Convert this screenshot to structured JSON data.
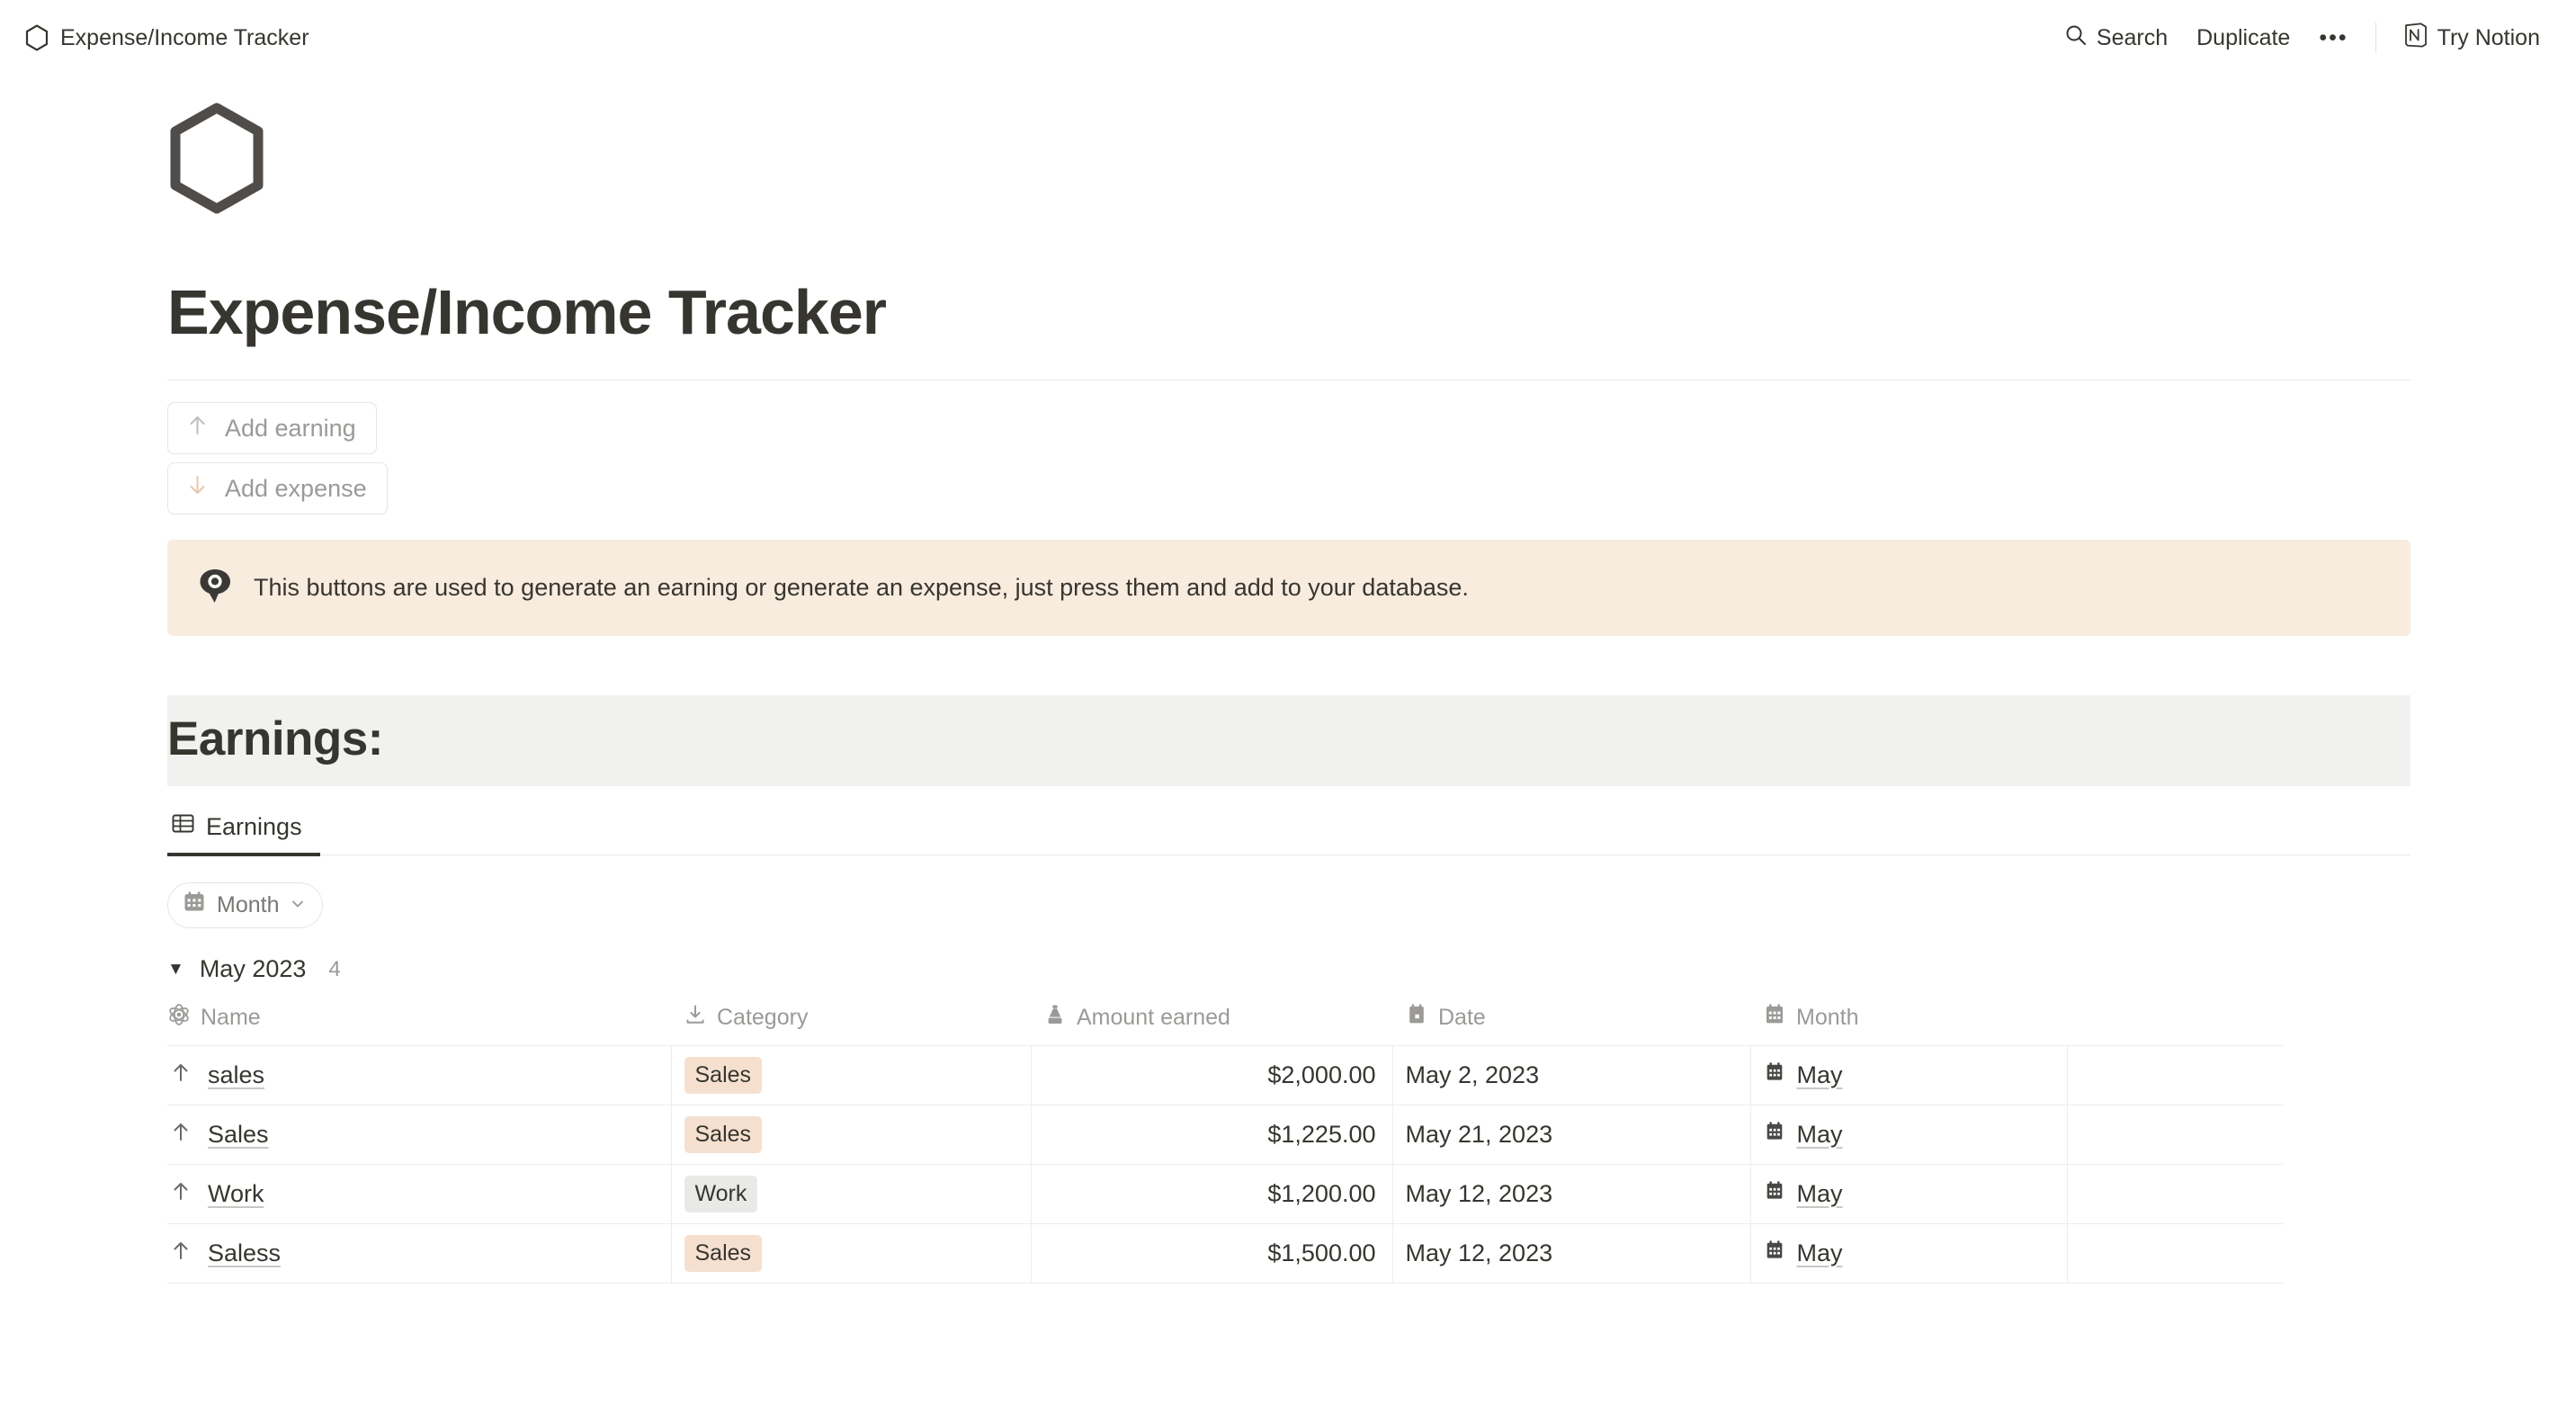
{
  "topbar": {
    "workspace_title": "Expense/Income Tracker",
    "search_label": "Search",
    "duplicate_label": "Duplicate",
    "more_label": "•••",
    "try_notion_label": "Try Notion"
  },
  "page": {
    "title": "Expense/Income Tracker"
  },
  "buttons": [
    {
      "label": "Add earning",
      "icon": "arrow-up-icon",
      "icon_color": "#bfbfbc"
    },
    {
      "label": "Add expense",
      "icon": "arrow-down-icon",
      "icon_color": "#e6c9ac"
    }
  ],
  "callout": {
    "icon": "eye-icon",
    "background": "#f8ecdf",
    "text": "This buttons are used to generate an earning or generate an expense, just press them and add to your database."
  },
  "section": {
    "heading": "Earnings:",
    "heading_background": "#f1f1ef"
  },
  "tabs": [
    {
      "label": "Earnings",
      "icon": "table-icon",
      "active": true
    }
  ],
  "filters": [
    {
      "label": "Month",
      "icon": "calendar-icon",
      "chevron": "chevron-down-icon"
    }
  ],
  "group": {
    "caret": "▼",
    "label": "May 2023",
    "count": "4"
  },
  "table": {
    "columns": [
      {
        "label": "Name",
        "icon": "atom-icon"
      },
      {
        "label": "Category",
        "icon": "download-icon"
      },
      {
        "label": "Amount earned",
        "icon": "flask-icon"
      },
      {
        "label": "Date",
        "icon": "calendar-icon"
      },
      {
        "label": "Month",
        "icon": "calendar-grid-icon"
      }
    ],
    "rows": [
      {
        "name": "sales",
        "name_icon": "arrow-up-icon",
        "category": "Sales",
        "category_color": "#f5e0d0",
        "amount": "$2,000.00",
        "date": "May 2, 2023",
        "month": "May",
        "month_icon": "calendar-grid-icon"
      },
      {
        "name": "Sales",
        "name_icon": "arrow-up-icon",
        "category": "Sales",
        "category_color": "#f5e0d0",
        "amount": "$1,225.00",
        "date": "May 21, 2023",
        "month": "May",
        "month_icon": "calendar-grid-icon"
      },
      {
        "name": "Work",
        "name_icon": "arrow-up-icon",
        "category": "Work",
        "category_color": "#e9e9e7",
        "amount": "$1,200.00",
        "date": "May 12, 2023",
        "month": "May",
        "month_icon": "calendar-grid-icon"
      },
      {
        "name": "Saless",
        "name_icon": "arrow-up-icon",
        "category": "Sales",
        "category_color": "#f5e0d0",
        "amount": "$1,500.00",
        "date": "May 12, 2023",
        "month": "May",
        "month_icon": "calendar-grid-icon"
      }
    ]
  }
}
